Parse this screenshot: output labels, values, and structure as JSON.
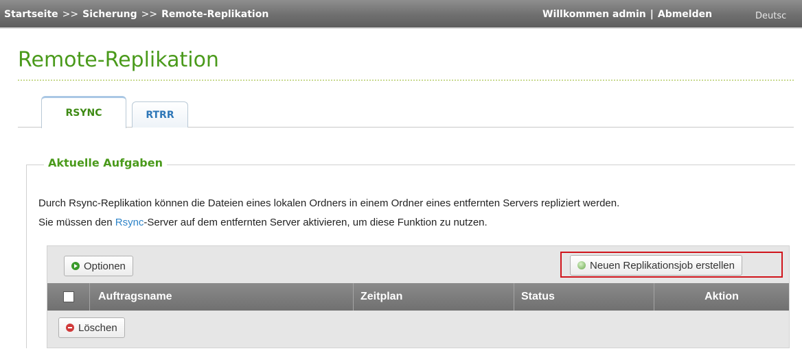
{
  "breadcrumb": {
    "home": "Startseite",
    "separator": ">>",
    "section": "Sicherung",
    "current": "Remote-Replikation"
  },
  "user": {
    "welcome": "Willkommen admin",
    "separator": "|",
    "logout": "Abmelden"
  },
  "language": "Deutsc",
  "page": {
    "title": "Remote-Replikation"
  },
  "tabs": [
    {
      "label": "RSYNC",
      "active": true
    },
    {
      "label": "RTRR",
      "active": false
    }
  ],
  "section": {
    "legend": "Aktuelle Aufgaben",
    "description_line1": "Durch Rsync-Replikation können die Dateien eines lokalen Ordners in einem Ordner eines entfernten Servers repliziert werden.",
    "description_line2_before": "Sie müssen den ",
    "description_line2_link": "Rsync",
    "description_line2_after": "-Server auf dem entfernten Server aktivieren, um diese Funktion zu nutzen."
  },
  "toolbar": {
    "options_label": "Optionen",
    "create_label": "Neuen Replikationsjob erstellen",
    "delete_label": "Löschen"
  },
  "table": {
    "columns": [
      "Auftragsname",
      "Zeitplan",
      "Status",
      "Aktion"
    ]
  },
  "colors": {
    "accent_green": "#4a9a1b",
    "link_blue": "#2f84c8",
    "highlight_red": "#d0141b",
    "topbar_gray": "#707070"
  },
  "icons": {
    "options": "play-circle-icon",
    "create": "add-circle-icon",
    "delete": "minus-circle-icon"
  }
}
